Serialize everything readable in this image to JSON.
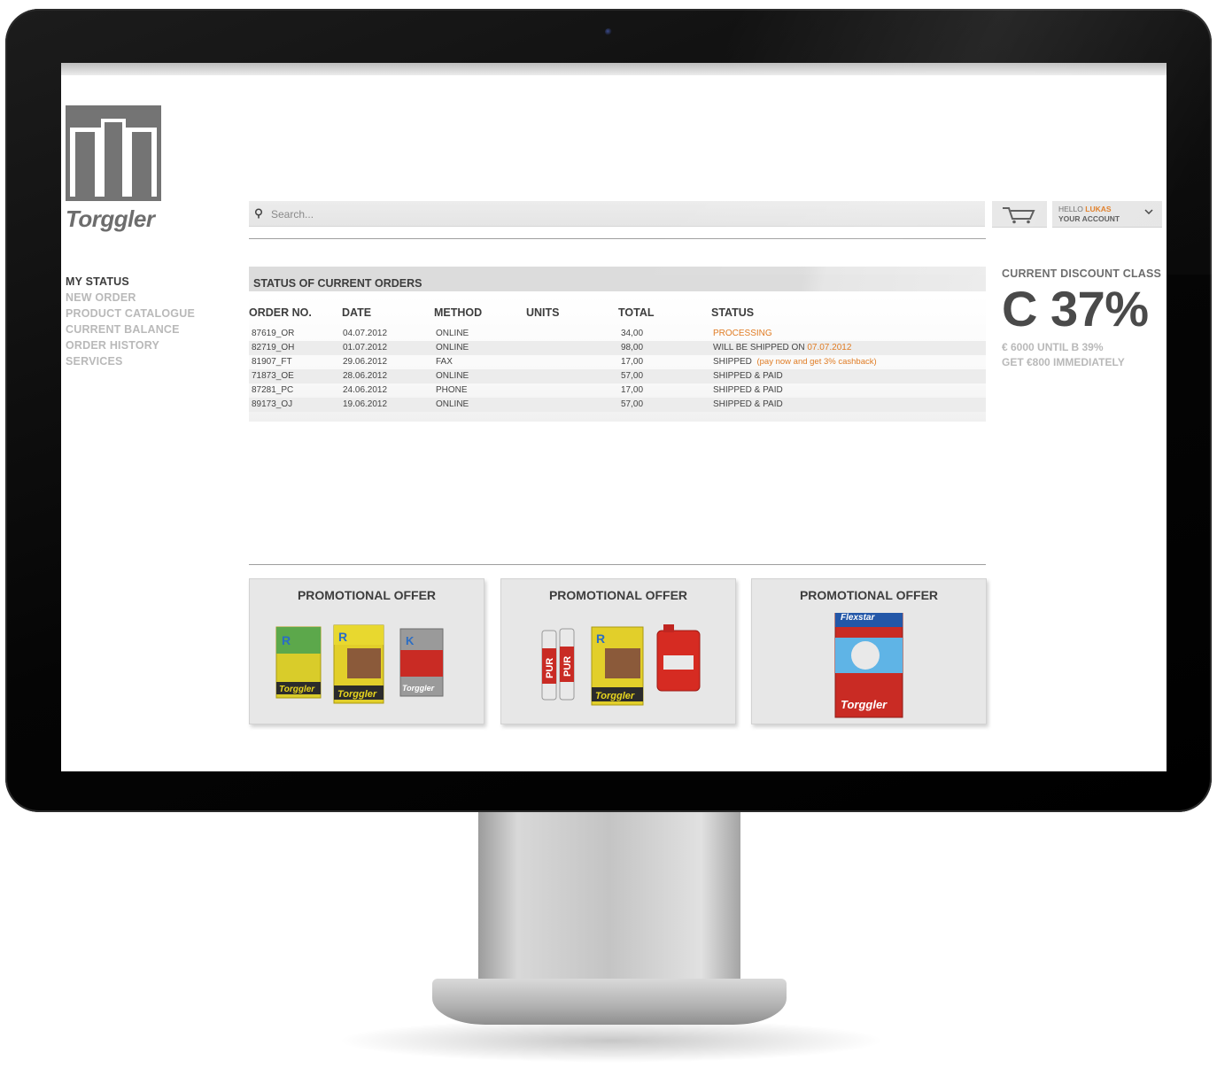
{
  "brand": {
    "name": "Torggler"
  },
  "nav": {
    "items": [
      {
        "label": "MY STATUS",
        "active": true
      },
      {
        "label": "NEW ORDER",
        "active": false
      },
      {
        "label": "PRODUCT CATALOGUE",
        "active": false
      },
      {
        "label": "CURRENT BALANCE",
        "active": false
      },
      {
        "label": "ORDER HISTORY",
        "active": false
      },
      {
        "label": "SERVICES",
        "active": false
      }
    ]
  },
  "search": {
    "placeholder": "Search...",
    "icon": "search-icon"
  },
  "header": {
    "cart_icon": "cart-icon",
    "account": {
      "greeting": "HELLO",
      "user": "LUKAS",
      "label": "YOUR ACCOUNT",
      "icon": "chevron-down-icon"
    }
  },
  "orders": {
    "title": "STATUS OF CURRENT ORDERS",
    "columns": [
      "ORDER NO.",
      "DATE",
      "METHOD",
      "UNITS",
      "TOTAL",
      "STATUS"
    ],
    "rows": [
      {
        "order_no": "87619_OR",
        "date": "04.07.2012",
        "method": "ONLINE",
        "total": "34,00",
        "status": "",
        "status_highlight": "PROCESSING"
      },
      {
        "order_no": "82719_OH",
        "date": "01.07.2012",
        "method": "ONLINE",
        "total": "98,00",
        "status": "WILL BE SHIPPED ON",
        "status_highlight": "07.07.2012"
      },
      {
        "order_no": "81907_FT",
        "date": "29.06.2012",
        "method": "FAX",
        "total": "17,00",
        "status": "SHIPPED",
        "status_highlight": "(pay now and get 3% cashback)"
      },
      {
        "order_no": "71873_OE",
        "date": "28.06.2012",
        "method": "ONLINE",
        "total": "57,00",
        "status": "SHIPPED & PAID",
        "status_highlight": ""
      },
      {
        "order_no": "87281_PC",
        "date": "24.06.2012",
        "method": "PHONE",
        "total": "17,00",
        "status": "SHIPPED & PAID",
        "status_highlight": ""
      },
      {
        "order_no": "89173_OJ",
        "date": "19.06.2012",
        "method": "ONLINE",
        "total": "57,00",
        "status": "SHIPPED & PAID",
        "status_highlight": ""
      }
    ]
  },
  "discount": {
    "title": "CURRENT DISCOUNT CLASS",
    "value": "C 37%",
    "note_1": "€ 6000 UNTIL B 39%",
    "note_2": "GET €800 IMMEDIATELY"
  },
  "promos": [
    {
      "title": "PROMOTIONAL OFFER"
    },
    {
      "title": "PROMOTIONAL OFFER"
    },
    {
      "title": "PROMOTIONAL OFFER"
    }
  ],
  "product_text": {
    "bag_logo": "Torggler",
    "can_label": "PUR",
    "bag_small_letter_1": "R",
    "bag_small_letter_2": "K",
    "bag_brand_3": "Flexstar"
  },
  "colors": {
    "accent": "#e07c24",
    "text_dark": "#3d3d3d",
    "nav_inactive": "#b9b9b9"
  }
}
